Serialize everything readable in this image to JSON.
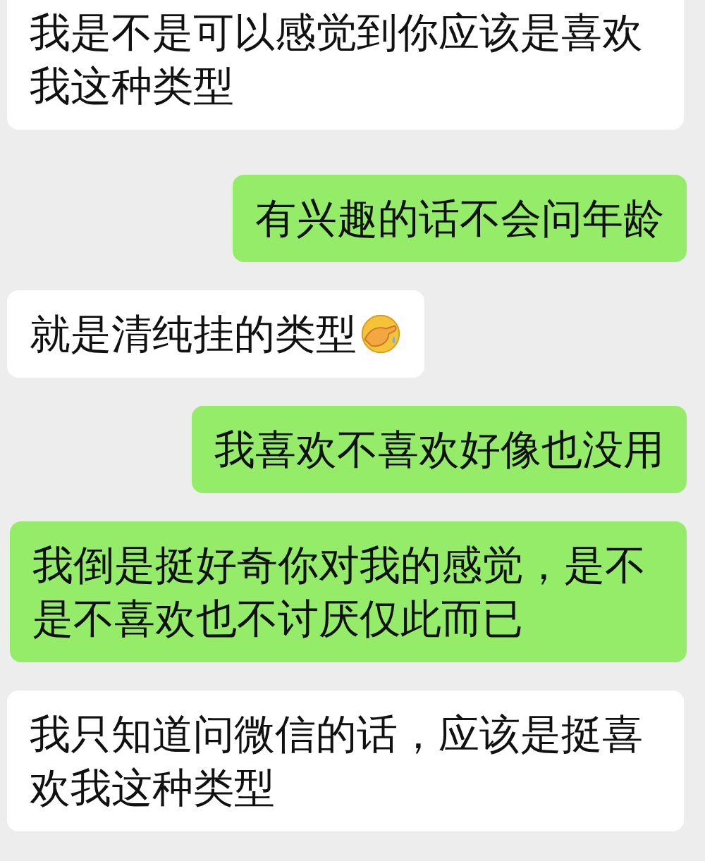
{
  "messages": [
    {
      "kind": "received",
      "text": "我是不是可以感觉到你应该是喜欢我这种类型"
    },
    {
      "kind": "sent",
      "text": "有兴趣的话不会问年龄"
    },
    {
      "kind": "received",
      "text": "就是清纯挂的类型",
      "emoji": true
    },
    {
      "kind": "sent",
      "text": "我喜欢不喜欢好像也没用"
    },
    {
      "kind": "sent",
      "text": "我倒是挺好奇你对我的感觉，是不是不喜欢也不讨厌仅此而已"
    },
    {
      "kind": "received",
      "text": "我只知道问微信的话，应该是挺喜欢我这种类型"
    }
  ]
}
